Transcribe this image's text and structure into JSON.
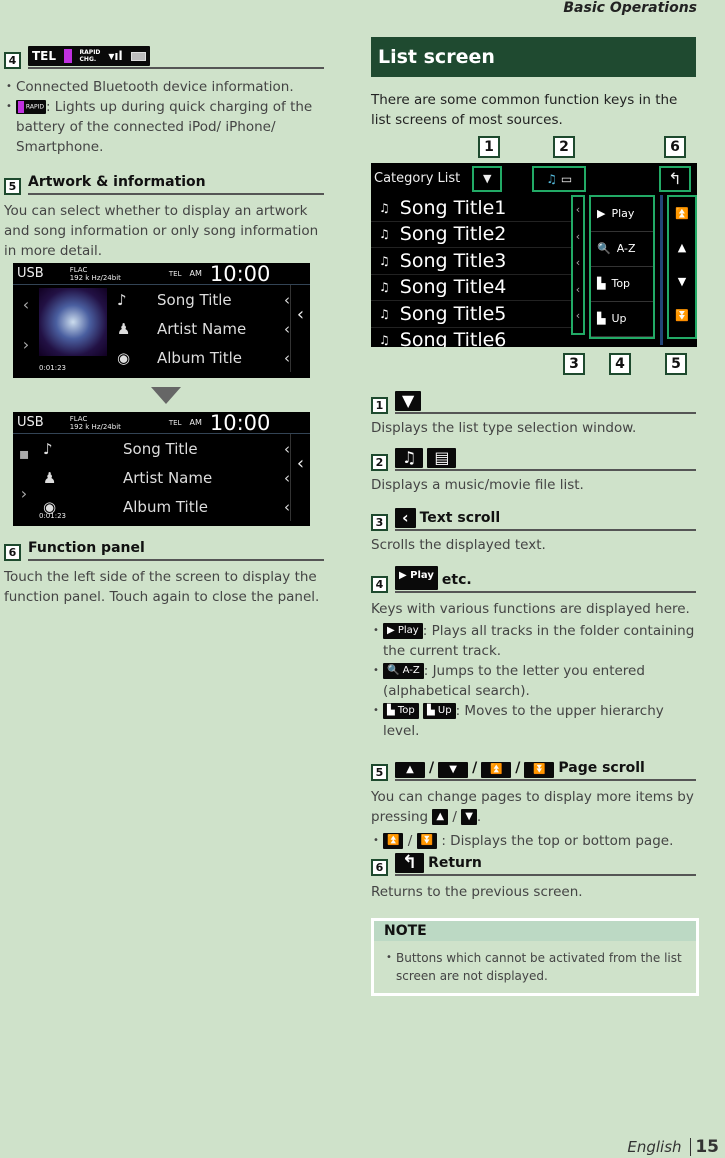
{
  "running_header": "Basic Operations",
  "left": {
    "s4": {
      "num": "4",
      "icons": {
        "tel": "TEL",
        "rapid": "RAPID",
        "chg": "CHG."
      },
      "bullets": [
        "Connected Bluetooth device information.",
        ": Lights up during quick charging of the battery of the connected iPod/ iPhone/ Smartphone."
      ]
    },
    "s5": {
      "num": "5",
      "title": "Artwork & information",
      "text": "You can select whether to display an artwork and song information or only song information in more detail."
    },
    "screen": {
      "source": "USB",
      "format": "FLAC",
      "rate": "192 k Hz/24bit",
      "tel": "TEL",
      "ampm": "AM",
      "clock": "10:00",
      "song": "Song Title",
      "artist": "Artist Name",
      "album": "Album Title",
      "time": "0:01:23"
    },
    "s6": {
      "num": "6",
      "title": "Function panel",
      "text": "Touch the left side of the screen to display the function panel. Touch again to close the panel."
    }
  },
  "right": {
    "title": "List screen",
    "intro": "There are some common function keys in the list screens of most sources.",
    "list": {
      "header": "Category List",
      "songs": [
        "Song Title1",
        "Song Title2",
        "Song Title3",
        "Song Title4",
        "Song Title5",
        "Song Title6"
      ],
      "keys": [
        "Play",
        "A-Z",
        "Top",
        "Up"
      ],
      "callouts_top": [
        "1",
        "2",
        "6"
      ],
      "callouts_bottom": [
        "3",
        "4",
        "5"
      ]
    },
    "items": [
      {
        "num": "1",
        "title": "",
        "text": "Displays the list type selection window."
      },
      {
        "num": "2",
        "title": "",
        "text": "Displays a music/movie file list."
      },
      {
        "num": "3",
        "title": "Text scroll",
        "text": "Scrolls the displayed text."
      },
      {
        "num": "4",
        "title": "etc.",
        "key": "Play",
        "text": "Keys with various functions are displayed here.",
        "bullets": [
          {
            "keys": [
              "Play"
            ],
            "text": ": Plays all tracks in the folder containing the current track."
          },
          {
            "keys": [
              "A-Z"
            ],
            "text": ": Jumps to the letter you entered (alphabetical search)."
          },
          {
            "keys": [
              "Top",
              "Up"
            ],
            "text": ": Moves to the upper hierarchy level."
          }
        ]
      },
      {
        "num": "5",
        "title": "Page scroll",
        "sep": "/",
        "text": "You can change pages to display more items by pressing",
        "bullet": ": Displays the top or bottom page."
      },
      {
        "num": "6",
        "title": "Return",
        "text": "Returns to the previous screen."
      }
    ],
    "note": {
      "title": "NOTE",
      "text": "Buttons which cannot be activated from the list screen are not displayed."
    }
  },
  "footer": {
    "language": "English",
    "page": "15"
  },
  "colors": {
    "background": "#cfe2ca",
    "title_bar": "#1f4a30",
    "note_header": "#bcd9c4",
    "rapid_charge": "#c030e0"
  }
}
